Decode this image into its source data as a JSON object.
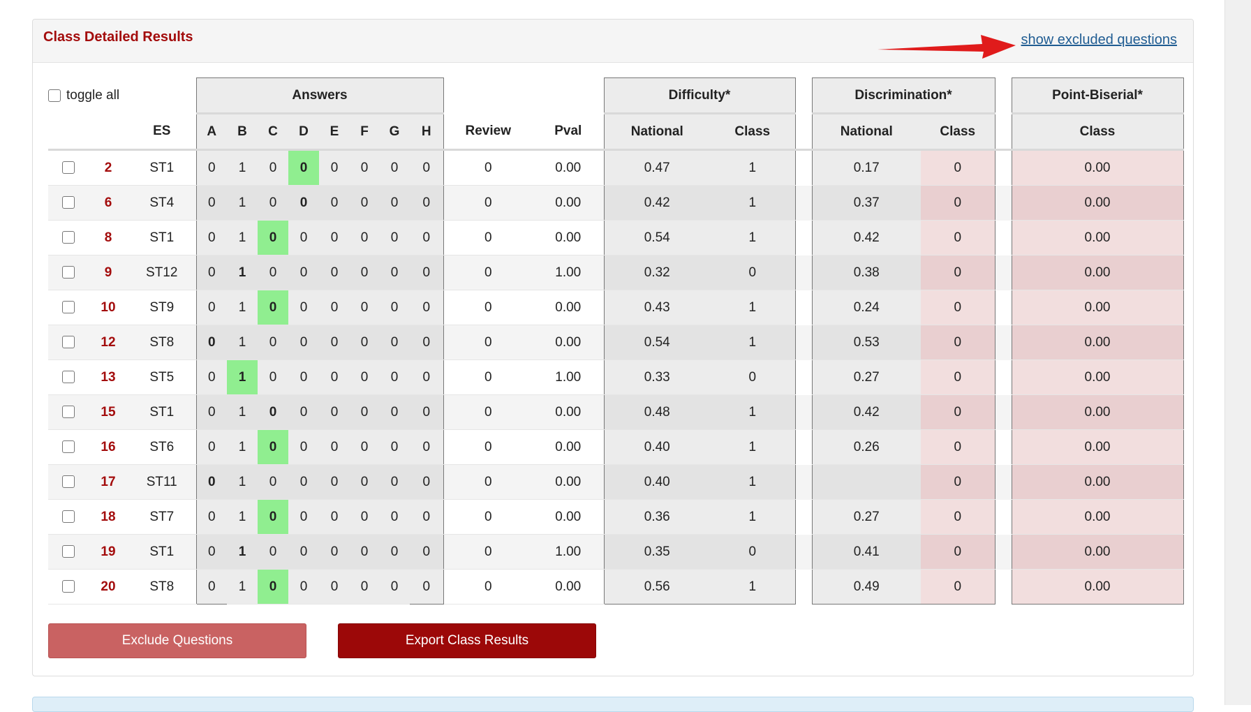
{
  "panel": {
    "title": "Class Detailed Results",
    "show_excluded_link": "show excluded questions",
    "toggle_all_label": "toggle all"
  },
  "headers": {
    "answers": "Answers",
    "difficulty": "Difficulty*",
    "discrimination": "Discrimination*",
    "point_biserial": "Point-Biserial*",
    "es": "ES",
    "letters": [
      "A",
      "B",
      "C",
      "D",
      "E",
      "F",
      "G",
      "H"
    ],
    "review": "Review",
    "pval": "Pval",
    "national": "National",
    "class": "Class"
  },
  "rows": [
    {
      "num": "2",
      "es": "ST1",
      "answers": [
        "0",
        "1",
        "0",
        "0",
        "0",
        "0",
        "0",
        "0"
      ],
      "correct": 3,
      "review": "0",
      "pval": "0.00",
      "diff_national": "0.47",
      "diff_class": "1",
      "disc_national": "0.17",
      "disc_class": "0",
      "pb_class": "0.00"
    },
    {
      "num": "6",
      "es": "ST4",
      "answers": [
        "0",
        "1",
        "0",
        "0",
        "0",
        "0",
        "0",
        "0"
      ],
      "correct": 3,
      "review": "0",
      "pval": "0.00",
      "diff_national": "0.42",
      "diff_class": "1",
      "disc_national": "0.37",
      "disc_class": "0",
      "pb_class": "0.00"
    },
    {
      "num": "8",
      "es": "ST1",
      "answers": [
        "0",
        "1",
        "0",
        "0",
        "0",
        "0",
        "0",
        "0"
      ],
      "correct": 2,
      "review": "0",
      "pval": "0.00",
      "diff_national": "0.54",
      "diff_class": "1",
      "disc_national": "0.42",
      "disc_class": "0",
      "pb_class": "0.00"
    },
    {
      "num": "9",
      "es": "ST12",
      "answers": [
        "0",
        "1",
        "0",
        "0",
        "0",
        "0",
        "0",
        "0"
      ],
      "correct": 1,
      "review": "0",
      "pval": "1.00",
      "diff_national": "0.32",
      "diff_class": "0",
      "disc_national": "0.38",
      "disc_class": "0",
      "pb_class": "0.00"
    },
    {
      "num": "10",
      "es": "ST9",
      "answers": [
        "0",
        "1",
        "0",
        "0",
        "0",
        "0",
        "0",
        "0"
      ],
      "correct": 2,
      "review": "0",
      "pval": "0.00",
      "diff_national": "0.43",
      "diff_class": "1",
      "disc_national": "0.24",
      "disc_class": "0",
      "pb_class": "0.00"
    },
    {
      "num": "12",
      "es": "ST8",
      "answers": [
        "0",
        "1",
        "0",
        "0",
        "0",
        "0",
        "0",
        "0"
      ],
      "correct": 0,
      "review": "0",
      "pval": "0.00",
      "diff_national": "0.54",
      "diff_class": "1",
      "disc_national": "0.53",
      "disc_class": "0",
      "pb_class": "0.00"
    },
    {
      "num": "13",
      "es": "ST5",
      "answers": [
        "0",
        "1",
        "0",
        "0",
        "0",
        "0",
        "0",
        "0"
      ],
      "correct": 1,
      "review": "0",
      "pval": "1.00",
      "diff_national": "0.33",
      "diff_class": "0",
      "disc_national": "0.27",
      "disc_class": "0",
      "pb_class": "0.00"
    },
    {
      "num": "15",
      "es": "ST1",
      "answers": [
        "0",
        "1",
        "0",
        "0",
        "0",
        "0",
        "0",
        "0"
      ],
      "correct": 2,
      "review": "0",
      "pval": "0.00",
      "diff_national": "0.48",
      "diff_class": "1",
      "disc_national": "0.42",
      "disc_class": "0",
      "pb_class": "0.00"
    },
    {
      "num": "16",
      "es": "ST6",
      "answers": [
        "0",
        "1",
        "0",
        "0",
        "0",
        "0",
        "0",
        "0"
      ],
      "correct": 2,
      "review": "0",
      "pval": "0.00",
      "diff_national": "0.40",
      "diff_class": "1",
      "disc_national": "0.26",
      "disc_class": "0",
      "pb_class": "0.00"
    },
    {
      "num": "17",
      "es": "ST11",
      "answers": [
        "0",
        "1",
        "0",
        "0",
        "0",
        "0",
        "0",
        "0"
      ],
      "correct": 0,
      "review": "0",
      "pval": "0.00",
      "diff_national": "0.40",
      "diff_class": "1",
      "disc_national": "",
      "disc_class": "0",
      "pb_class": "0.00"
    },
    {
      "num": "18",
      "es": "ST7",
      "answers": [
        "0",
        "1",
        "0",
        "0",
        "0",
        "0",
        "0",
        "0"
      ],
      "correct": 2,
      "review": "0",
      "pval": "0.00",
      "diff_national": "0.36",
      "diff_class": "1",
      "disc_national": "0.27",
      "disc_class": "0",
      "pb_class": "0.00"
    },
    {
      "num": "19",
      "es": "ST1",
      "answers": [
        "0",
        "1",
        "0",
        "0",
        "0",
        "0",
        "0",
        "0"
      ],
      "correct": 1,
      "review": "0",
      "pval": "1.00",
      "diff_national": "0.35",
      "diff_class": "0",
      "disc_national": "0.41",
      "disc_class": "0",
      "pb_class": "0.00"
    },
    {
      "num": "20",
      "es": "ST8",
      "answers": [
        "0",
        "1",
        "0",
        "0",
        "0",
        "0",
        "0",
        "0"
      ],
      "correct": 2,
      "review": "0",
      "pval": "0.00",
      "diff_national": "0.56",
      "diff_class": "1",
      "disc_national": "0.49",
      "disc_class": "0",
      "pb_class": "0.00"
    }
  ],
  "buttons": {
    "exclude": "Exclude Questions",
    "export": "Export Class Results"
  },
  "colors": {
    "accent": "#a30c0c",
    "correct_answer": "#90ee90",
    "link": "#1f5c92",
    "pink_cell": "#f2dede",
    "arrow": "#e01b1b"
  }
}
